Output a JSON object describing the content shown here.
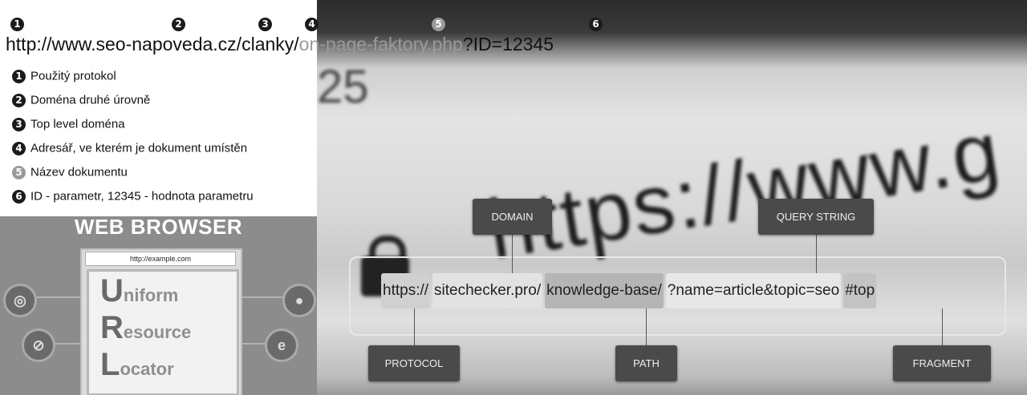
{
  "seo_example": {
    "markers": [
      "1",
      "2",
      "3",
      "4",
      "5",
      "6"
    ],
    "url_parts": {
      "protocol": "http://",
      "www": "www.",
      "domain": "seo-napoveda",
      "tld": ".cz/",
      "dir": "clanky/",
      "doc": "on-page-faktory.php",
      "param": "?ID=12345"
    },
    "legend": [
      {
        "num": "1",
        "text": "Použitý protokol"
      },
      {
        "num": "2",
        "text": "Doména druhé úrovně"
      },
      {
        "num": "3",
        "text": "Top level doména"
      },
      {
        "num": "4",
        "text": "Adresář, ve kterém je dokument umístěn"
      },
      {
        "num": "5",
        "text": "Název dokumentu"
      },
      {
        "num": "6",
        "text": "ID - parametr, 12345 - hodnota parametru"
      }
    ]
  },
  "web_browser": {
    "title": "WEB BROWSER",
    "address": "http://example.com",
    "acronym": [
      {
        "letter": "U",
        "rest": "niform"
      },
      {
        "letter": "R",
        "rest": "esource"
      },
      {
        "letter": "L",
        "rest": "ocator"
      }
    ],
    "browser_icons": [
      "chrome-icon",
      "firefox-icon",
      "safari-icon",
      "edge-icon"
    ]
  },
  "anatomy": {
    "segments": {
      "protocol": "https://",
      "domain": "sitechecker.pro/",
      "path": "knowledge-base/",
      "query": "?name=article&topic=seo",
      "fragment": "#top"
    },
    "labels": {
      "domain": "DOMAIN",
      "query": "QUERY STRING",
      "protocol": "PROTOCOL",
      "path": "PATH",
      "fragment": "FRAGMENT"
    }
  },
  "background": {
    "blurred_url": "https://www.g",
    "blurred_number": "25"
  }
}
